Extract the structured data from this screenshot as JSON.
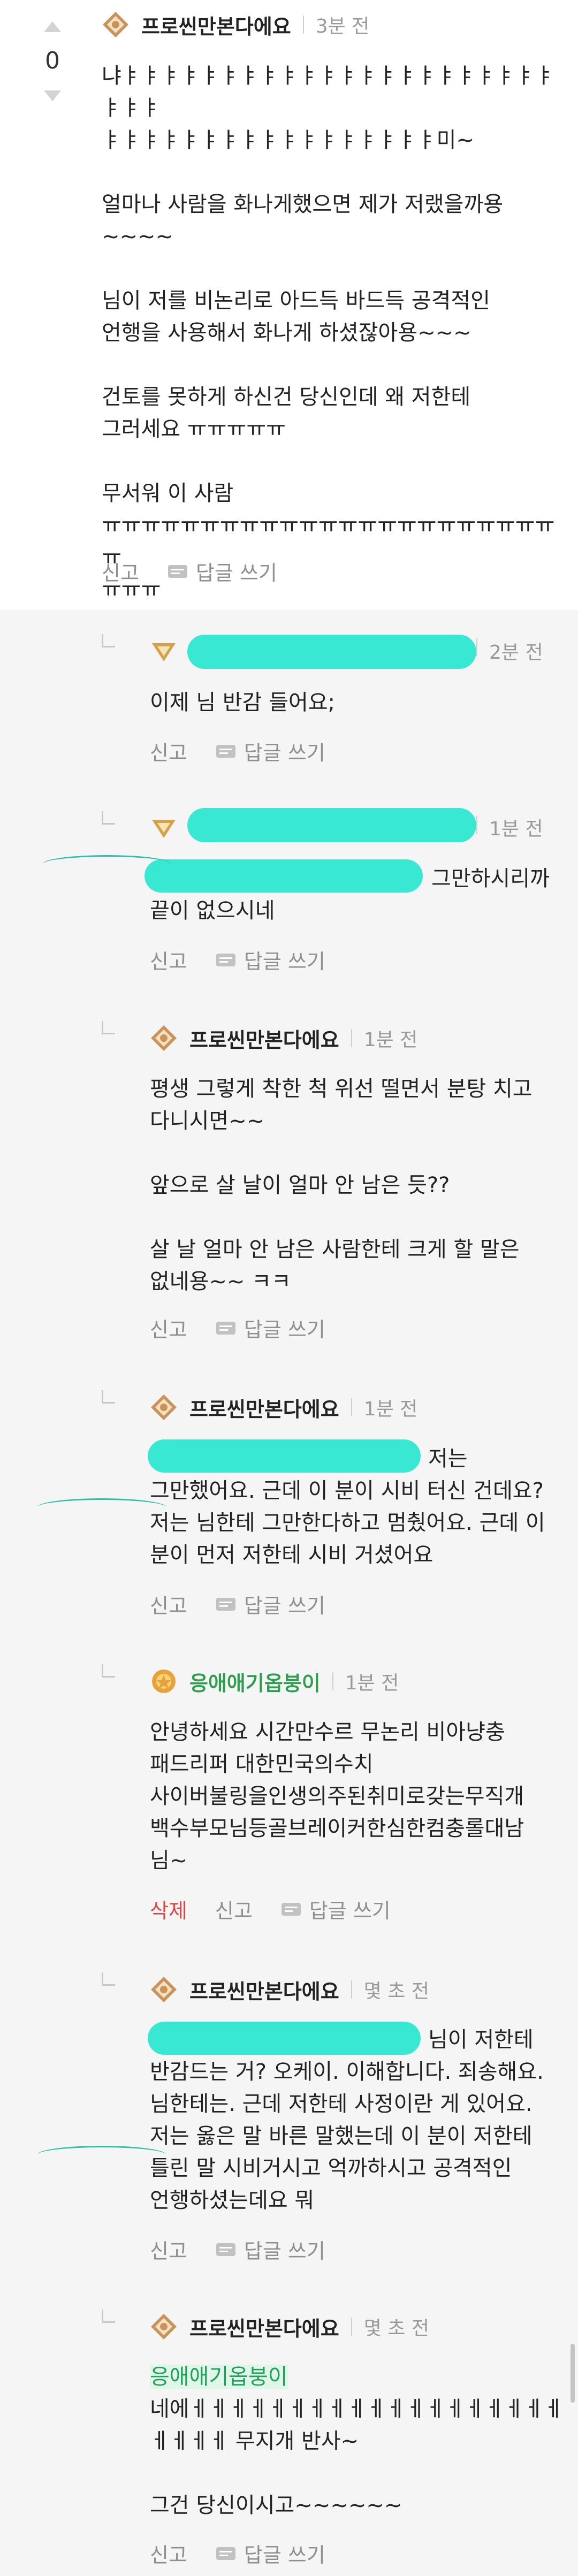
{
  "vote": {
    "count": "0"
  },
  "main_comment": {
    "nickname": "프로씬만본다에요",
    "time": "3분 전",
    "text": "냐ㅑㅑㅑㅑㅑㅑㅑㅑㅑㅑㅑㅑㅑㅑㅑㅑㅑㅑㅑㅑㅑㅑㅑㅑㅑ\nㅑㅑㅑㅑㅑㅑㅑㅑㅑㅑㅑㅑㅑㅑㅑㅑㅑ미~\n\n얼마나 사람을 화나게했으면 제가 저랬을까용\n~~~~\n\n님이 저를 비논리로 아드득 바드득 공격적인\n언행을 사용해서 화나게 하셨잖아용~~~\n\n건토를 못하게 하신건 당신인데 왜 저한테\n그러세요 ㅠㅠㅠㅠㅠ\n\n무서워 이 사람\nㅠㅠㅠㅠㅠㅠㅠㅠㅠㅠㅠㅠㅠㅠㅠㅠㅠㅠㅠㅠㅠㅠㅠㅠ\nㅠㅠㅠ"
  },
  "actions": {
    "report": "신고",
    "reply": "답글 쓰기",
    "delete": "삭제"
  },
  "replies": [
    {
      "time": "2분 전",
      "text": "이제 님 반감 들어요;"
    },
    {
      "time": "1분 전",
      "line1": "그만하시리까",
      "line2": "끝이 없으시네"
    },
    {
      "nickname": "프로씬만본다에요",
      "time": "1분 전",
      "text": "평생 그렇게 착한 척 위선 떨면서 분탕 치고\n다니시면~~\n\n앞으로 살 날이 얼마 안 남은 듯??\n\n살 날 얼마 안 남은 사람한테 크게 할 말은\n없네용~~ ㅋㅋ"
    },
    {
      "nickname": "프로씬만본다에요",
      "time": "1분 전",
      "line1": "저는",
      "text": "그만했어요. 근데 이 분이 시비 터신 건데요?\n저는 님한테 그만한다하고 멈췄어요. 근데 이\n분이 먼저 저한테 시비 거셨어요"
    },
    {
      "nickname": "응애애기옵붕이",
      "time": "1분 전",
      "text": "안녕하세요 시간만수르 무논리 비아냥충\n패드리퍼 대한민국의수치\n사이버불링을인생의주된취미로갖는무직개\n백수부모님등골브레이커한심한컴충롤대남\n님~"
    },
    {
      "nickname": "프로씬만본다에요",
      "time": "몇 초 전",
      "line1": "님이 저한테",
      "text": "반감드는 거? 오케이. 이해합니다. 죄송해요.\n님한테는. 근데 저한테 사정이란 게 있어요.\n저는 옳은 말 바른 말했는데 이 분이 저한테\n틀린 말 시비거시고 억까하시고 공격적인\n언행하셨는데요 뭐"
    },
    {
      "nickname": "프로씬만본다에요",
      "time": "몇 초 전",
      "mention": "응애애기옵붕이",
      "text": "네에ㅔㅔㅔㅔㅔㅔㅔㅔㅔㅔㅔㅔㅔㅔㅔㅔㅔㅔㅔ\nㅔㅔㅔㅔ 무지개 반사~\n\n그건 당신이시고~~~~~~"
    }
  ]
}
